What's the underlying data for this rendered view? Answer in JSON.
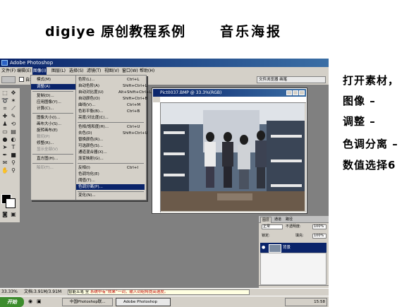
{
  "heading": {
    "title": "digiye 原创教程系例",
    "subtitle": "音乐海报"
  },
  "instructions": [
    "打开素材，",
    "图像 –",
    "调整 –",
    "色调分离 –",
    "数值选择6"
  ],
  "photoshop": {
    "window_title": "Adobe Photoshop",
    "menubar": [
      "文件(F)",
      "编辑(E)",
      "图像(I)",
      "图层(L)",
      "选择(S)",
      "滤镜(T)",
      "视图(V)",
      "窗口(W)",
      "帮助(H)"
    ],
    "active_menu": "图像(I)",
    "options_label": "自动",
    "palette_tab": "文件浏览器  画笔",
    "image_menu": [
      {
        "label": "模式(M)"
      },
      {
        "label": "调整(A)",
        "highlight": true
      },
      {
        "label": "复制(D)..."
      },
      {
        "label": "应用图像(Y)..."
      },
      {
        "label": "计算(C)..."
      },
      {
        "label": "图像大小(I)..."
      },
      {
        "label": "画布大小(S)..."
      },
      {
        "label": "旋转画布(E)"
      },
      {
        "label": "裁切(P)"
      },
      {
        "label": "修整(R)..."
      },
      {
        "label": "显示全部(V)"
      },
      {
        "label": "直方图(H)..."
      },
      {
        "label": "陷印(T)..."
      }
    ],
    "adjust_submenu": [
      {
        "label": "色阶(L)...",
        "shortcut": "Ctrl+L"
      },
      {
        "label": "自动色阶(A)",
        "shortcut": "Shift+Ctrl+L"
      },
      {
        "label": "自动对比度(U)",
        "shortcut": "Alt+Shift+Ctrl+L"
      },
      {
        "label": "自动颜色(O)",
        "shortcut": "Shift+Ctrl+B"
      },
      {
        "label": "曲线(V)...",
        "shortcut": "Ctrl+M"
      },
      {
        "label": "色彩平衡(B)...",
        "shortcut": "Ctrl+B"
      },
      {
        "label": "亮度/对比度(C)..."
      },
      {
        "label": "色相/饱和度(H)...",
        "shortcut": "Ctrl+U"
      },
      {
        "label": "去色(D)",
        "shortcut": "Shift+Ctrl+U"
      },
      {
        "label": "替换颜色(R)..."
      },
      {
        "label": "可选颜色(S)..."
      },
      {
        "label": "通道混合器(X)..."
      },
      {
        "label": "渐变映射(G)..."
      },
      {
        "label": "反相(I)",
        "shortcut": "Ctrl+I"
      },
      {
        "label": "色调均化(E)"
      },
      {
        "label": "阈值(T)..."
      },
      {
        "label": "色调分离(P)...",
        "highlight": true
      },
      {
        "label": "变化(N)..."
      }
    ],
    "document_title": "Pict0037.BMP @ 33.3%(RGB)",
    "layers_panel": {
      "tabs": [
        "图层",
        "通道",
        "路径"
      ],
      "blend_mode": "正常",
      "opacity_label": "不透明度:",
      "opacity_value": "100%",
      "lock_label": "锁定:",
      "fill_label": "填充:",
      "fill_value": "100%",
      "layer_name": "背景"
    },
    "status": {
      "zoom": "33.33%",
      "doc_size": "文档:3.91M/3.91M"
    },
    "ime": {
      "name": "智能五笔",
      "mode": "全",
      "message": "系统中有“效果”一词，输入词组将提高速度。"
    },
    "taskbar": {
      "start_label": "开始",
      "tasks": [
        "中国Photoshop联...",
        "Adobe Photoshop"
      ],
      "clock": "15:58"
    }
  },
  "colors": {
    "titlebar": "#0a246a",
    "menu_bg": "#d4d0c8",
    "highlight": "#0a246a",
    "desktop": "#808080"
  }
}
